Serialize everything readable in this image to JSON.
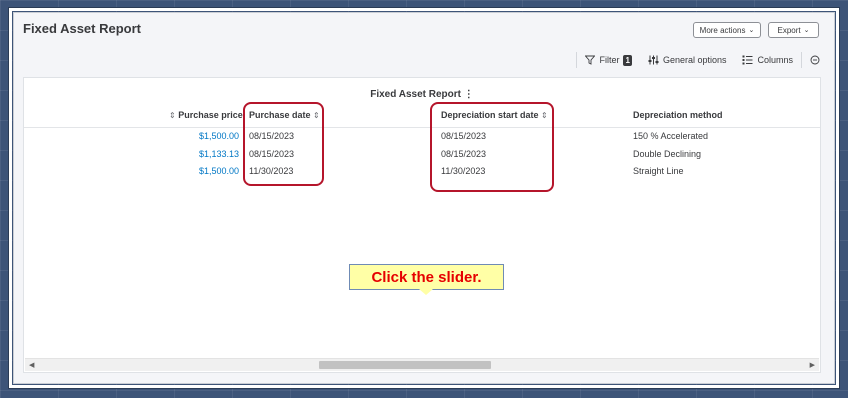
{
  "header": {
    "title": "Fixed Asset Report",
    "more_actions_label": "More actions",
    "export_label": "Export"
  },
  "toolbar": {
    "filter_label": "Filter",
    "filter_count": "1",
    "general_options_label": "General options",
    "columns_label": "Columns"
  },
  "report": {
    "title": "Fixed Asset Report",
    "columns": {
      "purchase_price": "Purchase price",
      "purchase_date": "Purchase date",
      "depreciation_start_date": "Depreciation start date",
      "depreciation_method": "Depreciation method"
    },
    "rows": [
      {
        "purchase_price": "$1,500.00",
        "purchase_date": "08/15/2023",
        "depreciation_start_date": "08/15/2023",
        "depreciation_method": "150 % Accelerated"
      },
      {
        "purchase_price": "$1,133.13",
        "purchase_date": "08/15/2023",
        "depreciation_start_date": "08/15/2023",
        "depreciation_method": "Double Declining"
      },
      {
        "purchase_price": "$1,500.00",
        "purchase_date": "11/30/2023",
        "depreciation_start_date": "11/30/2023",
        "depreciation_method": "Straight Line"
      }
    ]
  },
  "callout": {
    "text": "Click the slider."
  },
  "colors": {
    "highlight": "#b5152b",
    "link": "#0077c5",
    "callout_bg": "#ffffa6",
    "callout_text": "#e60000"
  }
}
